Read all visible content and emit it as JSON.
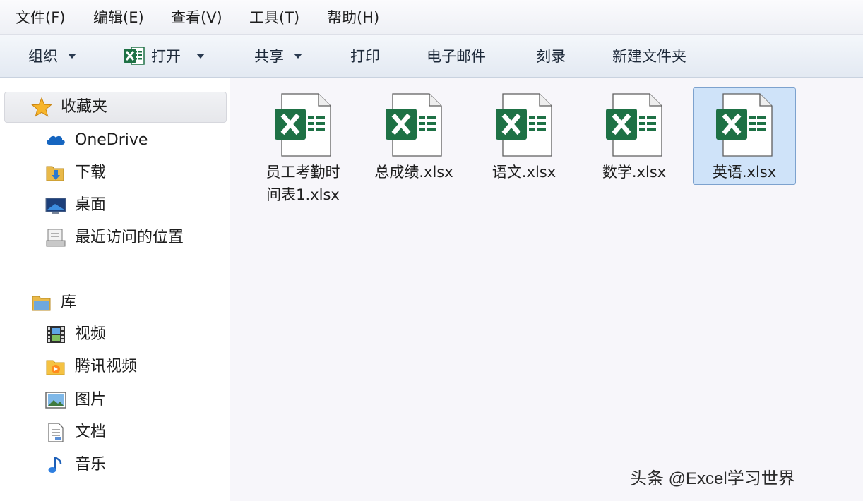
{
  "menubar": {
    "items": [
      {
        "label": "文件(F)"
      },
      {
        "label": "编辑(E)"
      },
      {
        "label": "查看(V)"
      },
      {
        "label": "工具(T)"
      },
      {
        "label": "帮助(H)"
      }
    ]
  },
  "toolbar": {
    "organize": "组织",
    "open": "打开",
    "share": "共享",
    "print": "打印",
    "email": "电子邮件",
    "burn": "刻录",
    "new_folder": "新建文件夹"
  },
  "nav": {
    "favorites": {
      "header": "收藏夹",
      "items": [
        {
          "label": "OneDrive",
          "icon": "onedrive-icon"
        },
        {
          "label": "下载",
          "icon": "downloads-folder-icon"
        },
        {
          "label": "桌面",
          "icon": "desktop-icon"
        },
        {
          "label": "最近访问的位置",
          "icon": "recent-places-icon"
        }
      ]
    },
    "libraries": {
      "header": "库",
      "items": [
        {
          "label": "视频",
          "icon": "video-library-icon"
        },
        {
          "label": "腾讯视频",
          "icon": "tencent-video-icon"
        },
        {
          "label": "图片",
          "icon": "pictures-library-icon"
        },
        {
          "label": "文档",
          "icon": "documents-library-icon"
        },
        {
          "label": "音乐",
          "icon": "music-library-icon"
        }
      ]
    }
  },
  "files": [
    {
      "line1": "员工考勤时",
      "line2": "间表1.xlsx",
      "selected": false
    },
    {
      "line1": "总成绩.xlsx",
      "line2": "",
      "selected": false
    },
    {
      "line1": "语文.xlsx",
      "line2": "",
      "selected": false
    },
    {
      "line1": "数学.xlsx",
      "line2": "",
      "selected": false
    },
    {
      "line1": "英语.xlsx",
      "line2": "",
      "selected": true
    }
  ],
  "watermark": "头条 @Excel学习世界",
  "colors": {
    "excel_green": "#1e7145",
    "selection_bg": "#cfe3f9",
    "selection_border": "#7da2ce"
  }
}
